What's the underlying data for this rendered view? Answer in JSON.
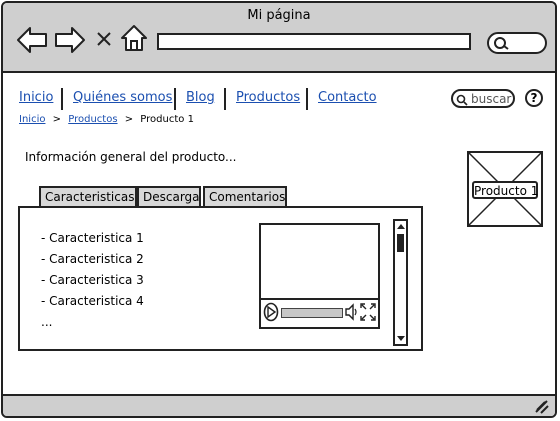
{
  "window": {
    "title": "Mi página"
  },
  "nav": {
    "items": [
      {
        "label": "Inicio"
      },
      {
        "label": "Quiénes somos"
      },
      {
        "label": "Blog"
      },
      {
        "label": "Productos"
      },
      {
        "label": "Contacto"
      }
    ]
  },
  "breadcrumb": {
    "items": [
      "Inicio",
      "Productos",
      "Producto 1"
    ]
  },
  "search": {
    "placeholder": "buscar"
  },
  "help": {
    "label": "?"
  },
  "main": {
    "info": "Información general del producto...",
    "tabs": [
      "Caracteristicas",
      "Descarga",
      "Comentarios"
    ],
    "features": [
      "- Caracteristica 1",
      "- Caracteristica 2",
      "- Caracteristica 3",
      "- Caracteristica 4",
      "..."
    ]
  },
  "product": {
    "image_label": "Producto 1"
  }
}
